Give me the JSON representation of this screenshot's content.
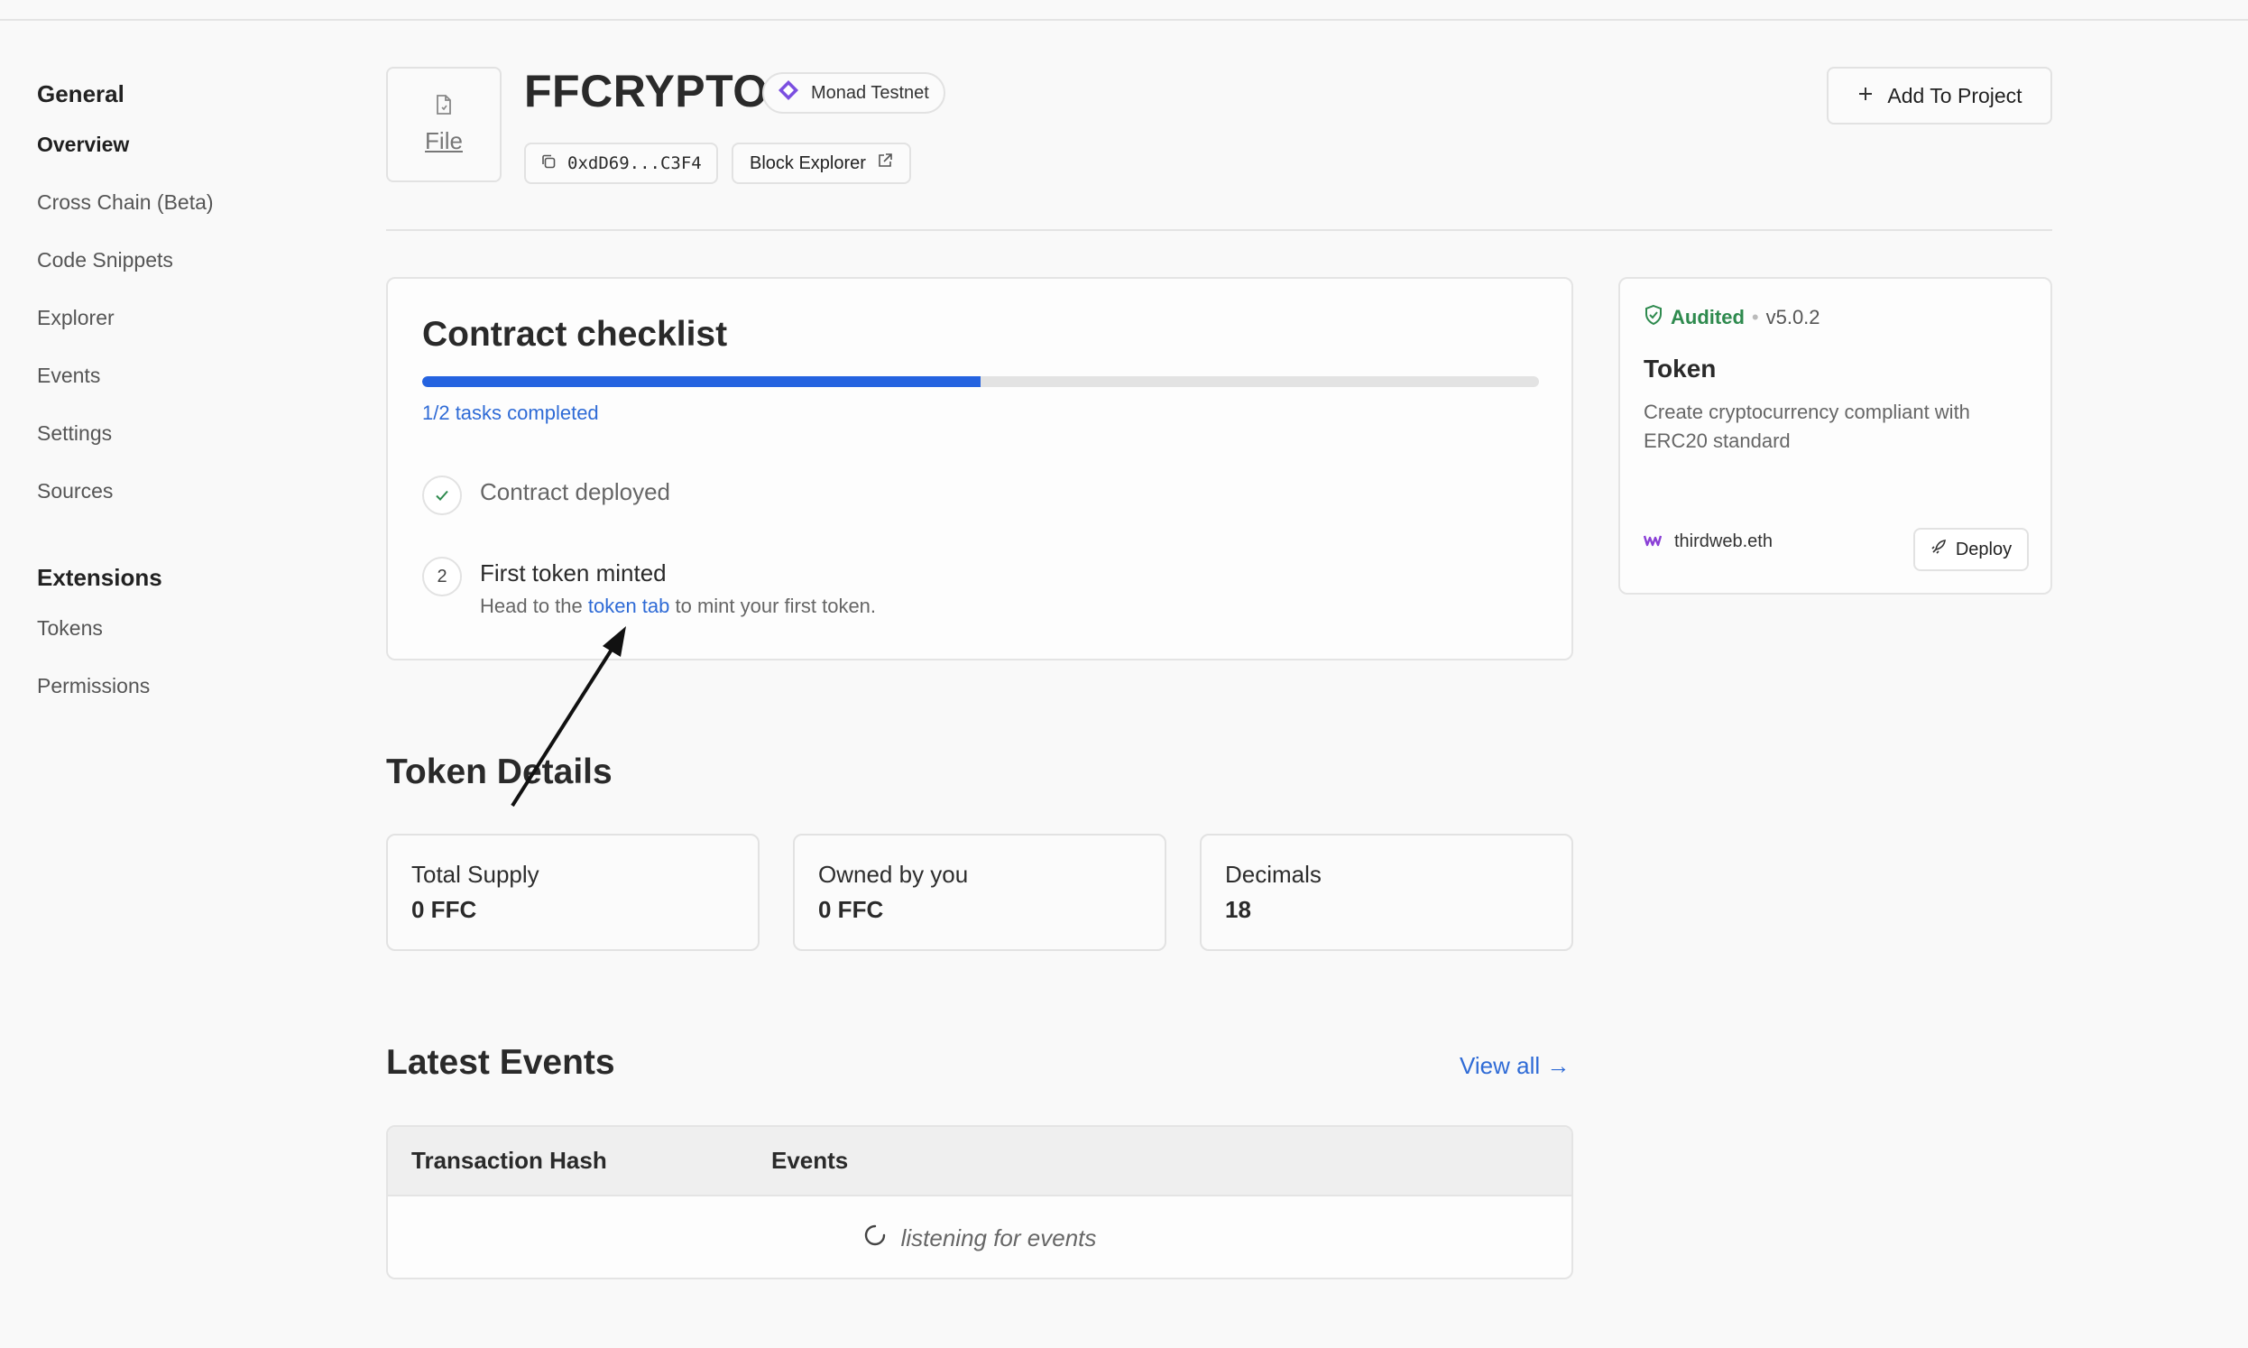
{
  "sidebar": {
    "general_heading": "General",
    "general_items": [
      "Overview",
      "Cross Chain (Beta)",
      "Code Snippets",
      "Explorer",
      "Events",
      "Settings",
      "Sources"
    ],
    "extensions_heading": "Extensions",
    "extensions_items": [
      "Tokens",
      "Permissions"
    ],
    "active_item": "Overview"
  },
  "header": {
    "file_label": "File",
    "contract_name": "FFCRYPTO",
    "chain_name": "Monad Testnet",
    "address_short": "0xdD69...C3F4",
    "block_explorer_label": "Block Explorer",
    "add_to_project_label": "Add To Project"
  },
  "checklist": {
    "title": "Contract checklist",
    "progress_fraction": 0.5,
    "tasks_completed_text": "1/2 tasks completed",
    "steps": [
      {
        "marker": "check-icon",
        "title": "Contract deployed"
      },
      {
        "marker": "2",
        "title": "First token minted",
        "desc_before": "Head to the ",
        "desc_link": "token tab",
        "desc_after": " to mint your first token."
      }
    ]
  },
  "token_card": {
    "audit_status": "Audited",
    "separator": "•",
    "version": "v5.0.2",
    "name": "Token",
    "description": "Create cryptocurrency compliant with ERC20 standard",
    "publisher": "thirdweb.eth",
    "deploy_label": "Deploy"
  },
  "token_details": {
    "title": "Token Details",
    "stats": [
      {
        "label": "Total Supply",
        "value": "0 FFC"
      },
      {
        "label": "Owned by you",
        "value": "0 FFC"
      },
      {
        "label": "Decimals",
        "value": "18"
      }
    ]
  },
  "latest_events": {
    "title": "Latest Events",
    "view_all_label": "View all →",
    "columns": [
      "Transaction Hash",
      "Events"
    ],
    "status_text": "listening for events"
  },
  "colors": {
    "accent": "#2563e0",
    "link": "#2f6bd6",
    "audited": "#2e8a4e",
    "chain_icon": "#7b4fe0",
    "publisher_icon": "#8a3fd6"
  }
}
